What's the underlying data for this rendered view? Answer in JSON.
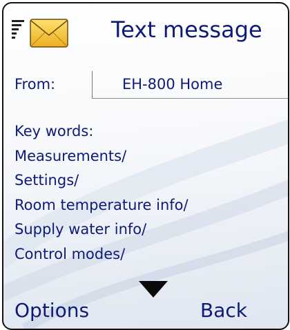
{
  "header": {
    "title": "Text message",
    "signal_icon": "signal-strength-icon",
    "message_icon": "envelope-icon"
  },
  "message": {
    "from_label": "From:",
    "from_value": "EH-800 Home",
    "lines": [
      "Key words:",
      "Measurements/",
      "Settings/",
      "Room temperature info/",
      "Supply water info/",
      "Control modes/"
    ]
  },
  "softkeys": {
    "left": "Options",
    "right": "Back",
    "scroll_icon": "scroll-down-arrow-icon"
  },
  "colors": {
    "text": "#0e1a78",
    "envelope_fill": "#f5c430",
    "envelope_outline": "#6b4a10"
  }
}
